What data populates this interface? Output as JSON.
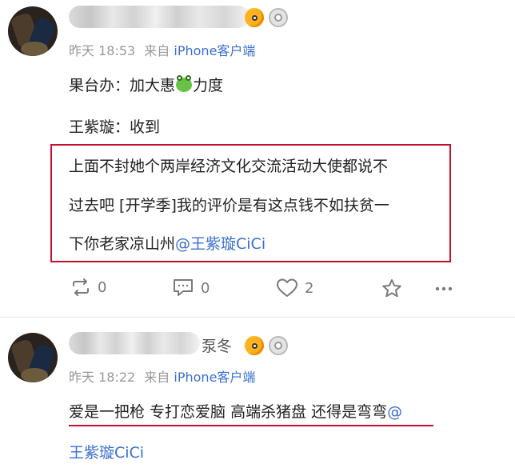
{
  "posts": [
    {
      "time": "昨天 18:53",
      "source_prefix": "来自",
      "source": "iPhone客户端",
      "lines": [
        {
          "text_before": "果台办：加大惠",
          "emoji": "frog",
          "text_after": "力度"
        },
        {
          "text": "王紫璇：收到"
        }
      ],
      "boxed_lines": [
        "上面不封她个两岸经济文化交流活动大使都说不",
        "过去吧 [开学季]我的评价是有这点钱不如扶贫一"
      ],
      "boxed_last_text": "下你老家凉山州",
      "boxed_last_mention": "@王紫璇CiCi",
      "actions": {
        "repost_count": "0",
        "comment_count": "0",
        "like_count": "2"
      },
      "highlight_color": "#c8102e"
    },
    {
      "time": "昨天 18:22",
      "source_prefix": "来自",
      "source": "iPhone客户端",
      "line1": "爱是一把枪 专打恋爱脑 高端杀猪盘 还得是弯弯",
      "line1_mention": "@",
      "line2_mention": "王紫璇CiCi",
      "name_fragment": "泵冬",
      "highlight_color": "#c8102e"
    }
  ],
  "icons": {
    "repost": "repost-icon",
    "comment": "comment-icon",
    "like": "heart-icon",
    "favorite": "star-icon",
    "more": "more-icon"
  },
  "colors": {
    "link": "#3a6fd1",
    "meta": "#999999",
    "highlight": "#c8102e"
  }
}
